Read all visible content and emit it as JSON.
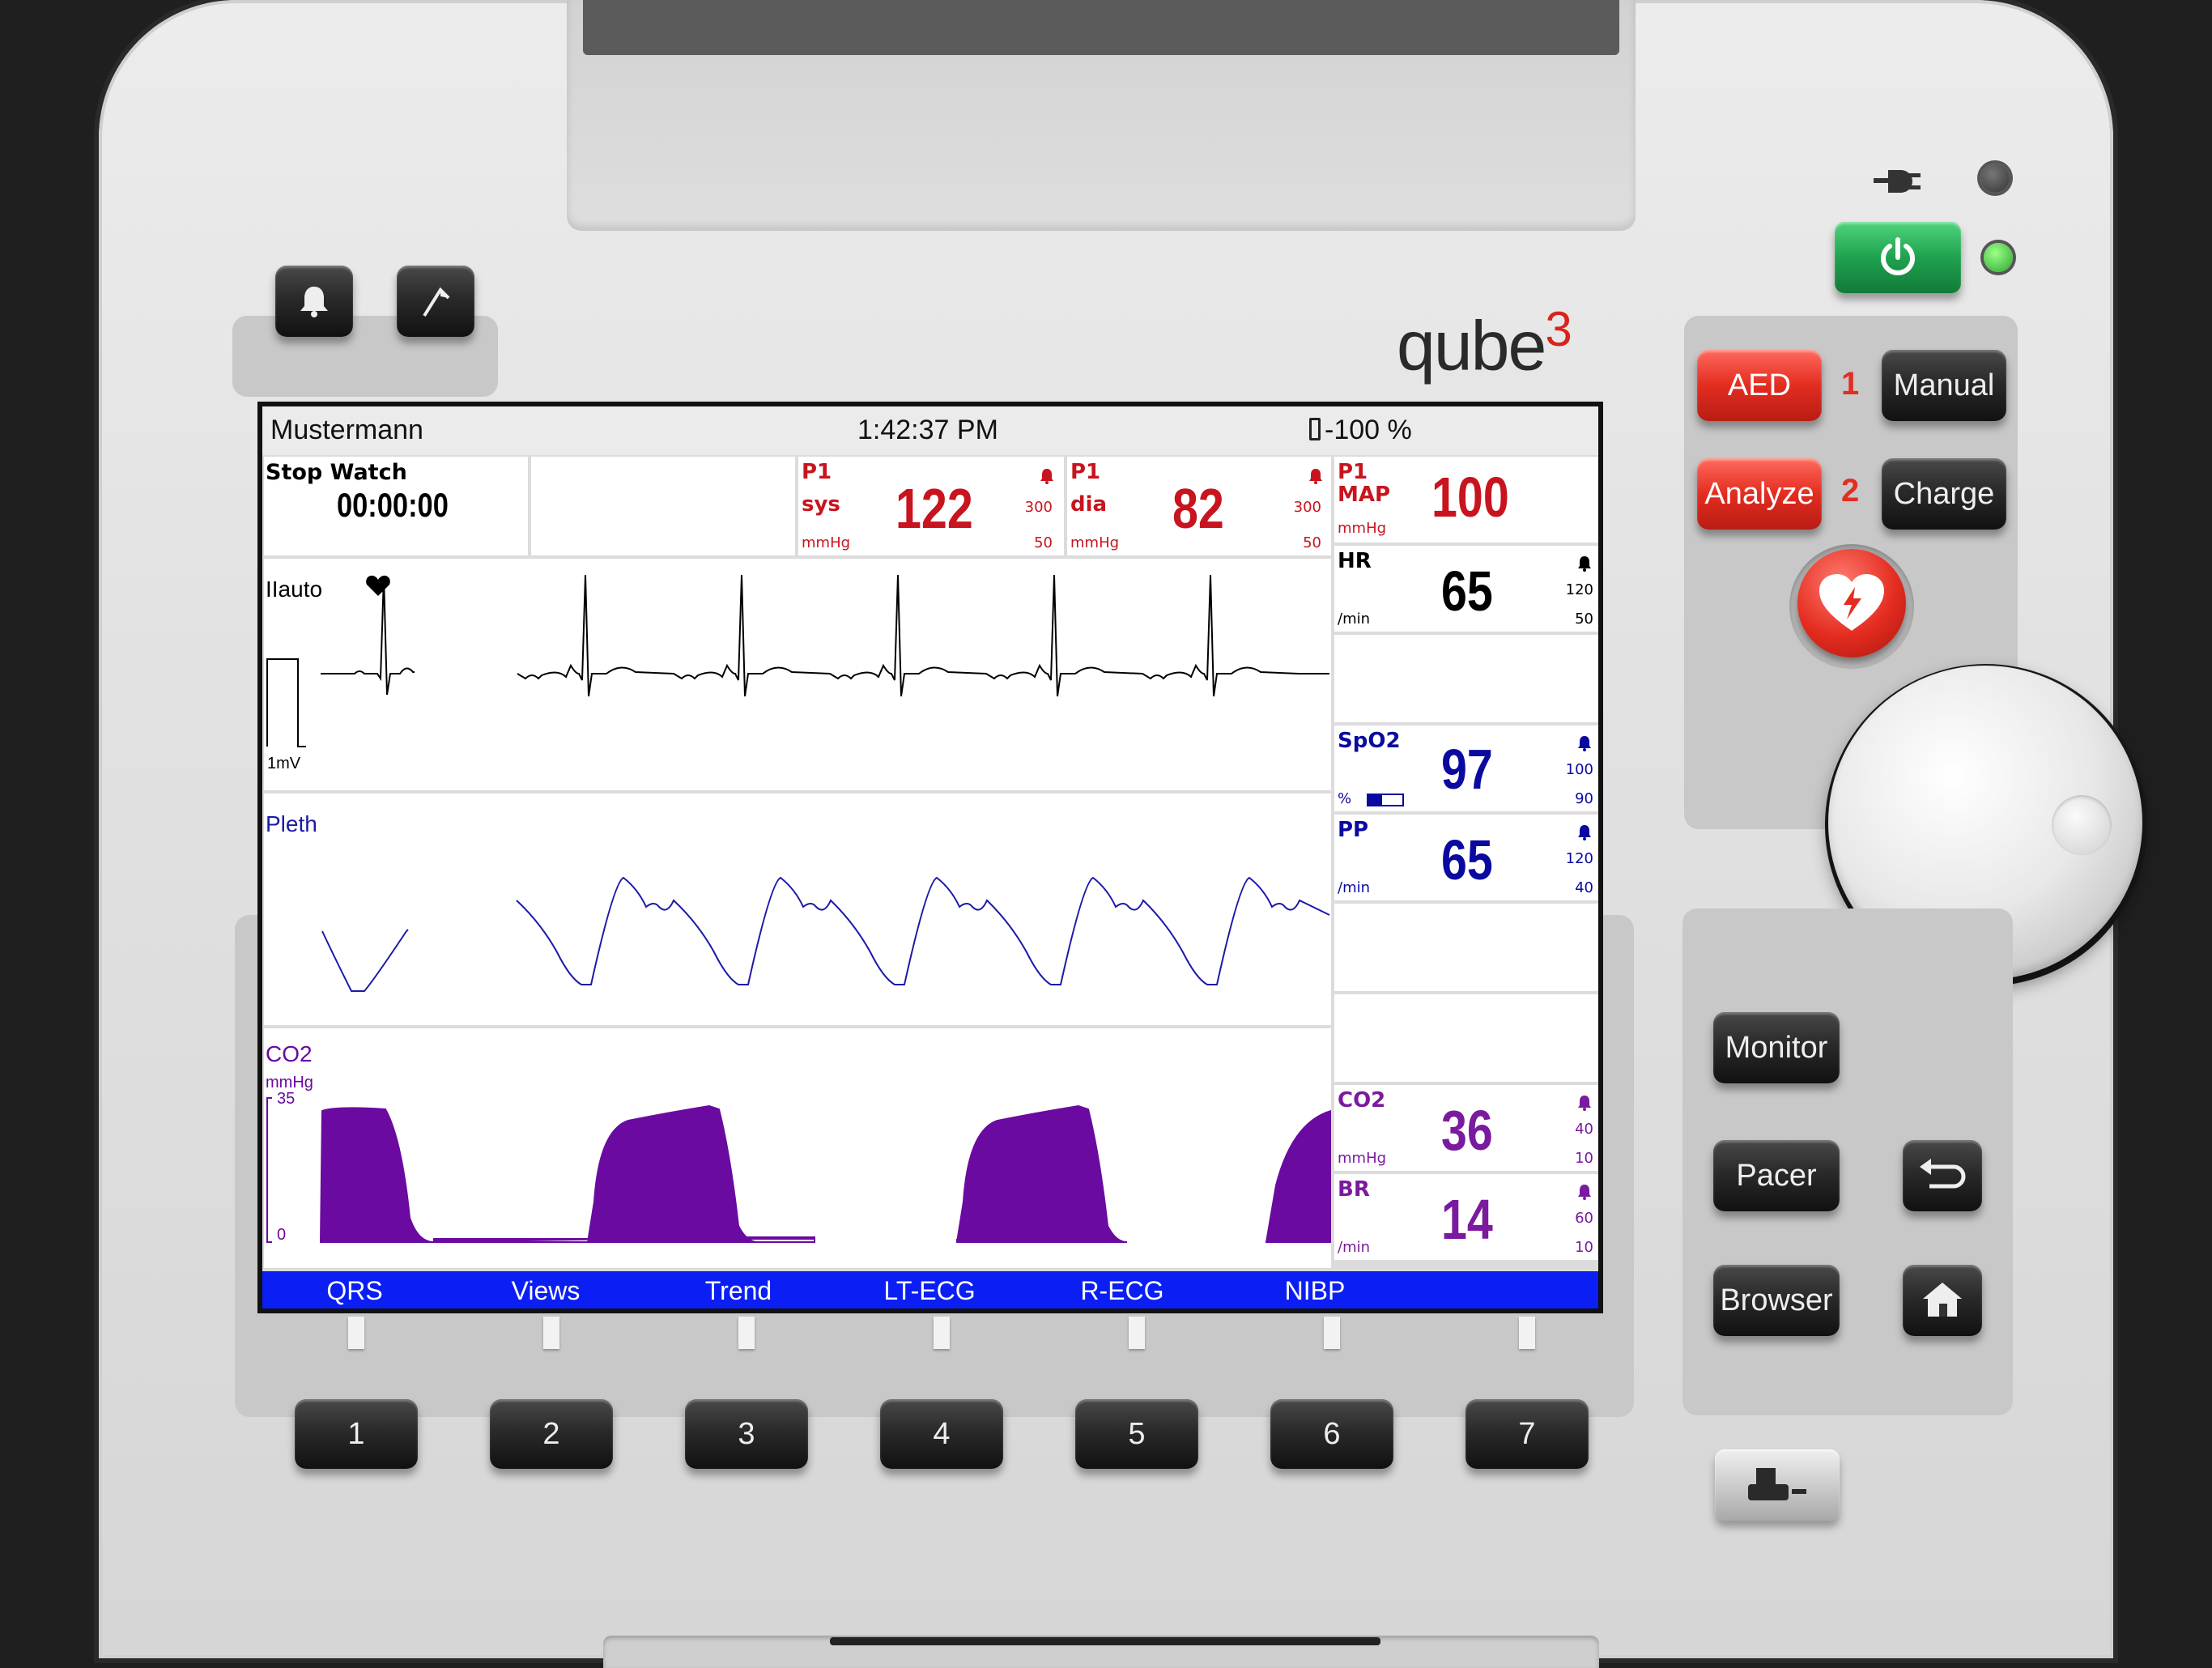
{
  "device": {
    "brand": "qube",
    "brand_superscript": "3"
  },
  "status_bar": {
    "patient_name": "Mustermann",
    "time": "1:42:37 PM",
    "battery_icon": "battery-icon",
    "battery": "-100 %"
  },
  "stopwatch": {
    "label": "Stop Watch",
    "value": "00:00:00"
  },
  "params": {
    "p1_sys": {
      "label1": "P1",
      "label2": "sys",
      "value": "122",
      "unit": "mmHg",
      "high": "300",
      "low": "50",
      "color": "#c8141e"
    },
    "p1_dia": {
      "label1": "P1",
      "label2": "dia",
      "value": "82",
      "unit": "mmHg",
      "high": "300",
      "low": "50",
      "color": "#c8141e"
    },
    "p1_map": {
      "label1": "P1",
      "label2": "MAP",
      "value": "100",
      "unit": "mmHg",
      "color": "#c8141e"
    },
    "hr": {
      "label": "HR",
      "value": "65",
      "unit": "/min",
      "high": "120",
      "low": "50",
      "color": "#000000"
    },
    "spo2": {
      "label": "SpO2",
      "value": "97",
      "unit": "%",
      "high": "100",
      "low": "90",
      "color": "#0a0aa0",
      "signal_bar_fraction": 0.4
    },
    "pp": {
      "label": "PP",
      "value": "65",
      "unit": "/min",
      "high": "120",
      "low": "40",
      "color": "#0a0aa0"
    },
    "co2": {
      "label": "CO2",
      "value": "36",
      "unit": "mmHg",
      "high": "40",
      "low": "10",
      "color": "#7a1a9e"
    },
    "br": {
      "label": "BR",
      "value": "14",
      "unit": "/min",
      "high": "60",
      "low": "10",
      "color": "#7a1a9e"
    }
  },
  "waveforms": {
    "ecg": {
      "label": "IIauto",
      "scale": "1mV",
      "color": "#000000"
    },
    "pleth": {
      "label": "Pleth",
      "color": "#1a1aa8"
    },
    "co2": {
      "label": "CO2",
      "unit": "mmHg",
      "scale_high": "35",
      "scale_low": "0",
      "color": "#6a0aa0"
    }
  },
  "softkeys": [
    "QRS",
    "Views",
    "Trend",
    "LT-ECG",
    "R-ECG",
    "NIBP"
  ],
  "hardkeys": [
    "1",
    "2",
    "3",
    "4",
    "5",
    "6",
    "7"
  ],
  "right_panel": {
    "aed": "AED",
    "manual": "Manual",
    "analyze": "Analyze",
    "charge": "Charge",
    "step1": "1",
    "step2": "2",
    "monitor": "Monitor",
    "pacer": "Pacer",
    "browser": "Browser"
  },
  "icons": {
    "alarm": "bell-icon",
    "event": "flag-icon",
    "power": "power-icon",
    "mains": "plug-icon",
    "shock": "shock-heart-icon",
    "back": "return-icon",
    "home": "home-icon",
    "print": "printer-icon",
    "knob": "rotary-knob",
    "heart": "heart-icon"
  },
  "colors": {
    "softbar": "#0b1ff5",
    "red_button": "#e42c20",
    "power_button": "#1ea24f",
    "led_on": "#3cdc3c"
  }
}
